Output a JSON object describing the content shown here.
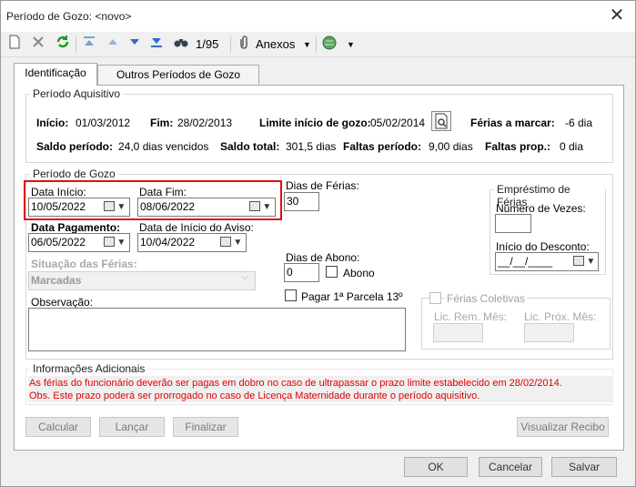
{
  "window": {
    "title": "Período de Gozo: <novo>",
    "close": "✕"
  },
  "toolbar": {
    "record": "1/95",
    "anexos": "Anexos"
  },
  "tabs": [
    "Identificação",
    "Outros Períodos de Gozo"
  ],
  "aquisitivo": {
    "legend": "Período Aquisitivo",
    "inicio_label": "Início:",
    "inicio": "01/03/2012",
    "fim_label": "Fim:",
    "fim": "28/02/2013",
    "limite_label": "Limite início de gozo:",
    "limite": "05/02/2014",
    "ferias_marcar_label": "Férias a marcar:",
    "ferias_marcar": "-6 dia",
    "saldo_periodo_label": "Saldo período:",
    "saldo_periodo": "24,0 dias vencidos",
    "saldo_total_label": "Saldo total:",
    "saldo_total": "301,5 dias",
    "faltas_periodo_label": "Faltas período:",
    "faltas_periodo": "9,00 dias",
    "faltas_prop_label": "Faltas prop.:",
    "faltas_prop": "0 dia"
  },
  "gozo": {
    "legend": "Período de Gozo",
    "data_inicio_label": "Data Início:",
    "data_inicio": "10/05/2022",
    "data_fim_label": "Data Fim:",
    "data_fim": "08/06/2022",
    "dias_ferias_label": "Dias de Férias:",
    "dias_ferias": "30",
    "data_pagamento_label": "Data Pagamento:",
    "data_pagamento": "06/05/2022",
    "data_aviso_label": "Data de Início do Aviso:",
    "data_aviso": "10/04/2022",
    "dias_abono_label": "Dias de Abono:",
    "dias_abono": "0",
    "abono_label": "Abono",
    "situacao_label": "Situação das Férias:",
    "situacao": "Marcadas",
    "pagar_label": "Pagar 1ª Parcela 13º",
    "observacao_label": "Observação:"
  },
  "emprestimo": {
    "legend": "Empréstimo de Férias",
    "numero_label": "Número de Vezes:",
    "inicio_desconto_label": "Início do Desconto:",
    "inicio_desconto": "__/__/____"
  },
  "coletivas": {
    "label": "Férias Coletivas",
    "lic_rem_label": "Lic. Rem. Mês:",
    "lic_prox_label": "Lic. Próx. Mês:"
  },
  "info": {
    "legend": "Informações Adicionais",
    "line1": "As férias do funcionário deverão ser pagas em dobro no caso de ultrapassar o prazo limite estabelecido em 28/02/2014.",
    "line2": "Obs. Este prazo poderá ser prorrogado no caso de Licença Maternidade durante o período aquisitivo."
  },
  "actions": {
    "calcular": "Calcular",
    "lancar": "Lançar",
    "finalizar": "Finalizar",
    "visualizar": "Visualizar Recibo"
  },
  "footer": {
    "ok": "OK",
    "cancelar": "Cancelar",
    "salvar": "Salvar"
  }
}
